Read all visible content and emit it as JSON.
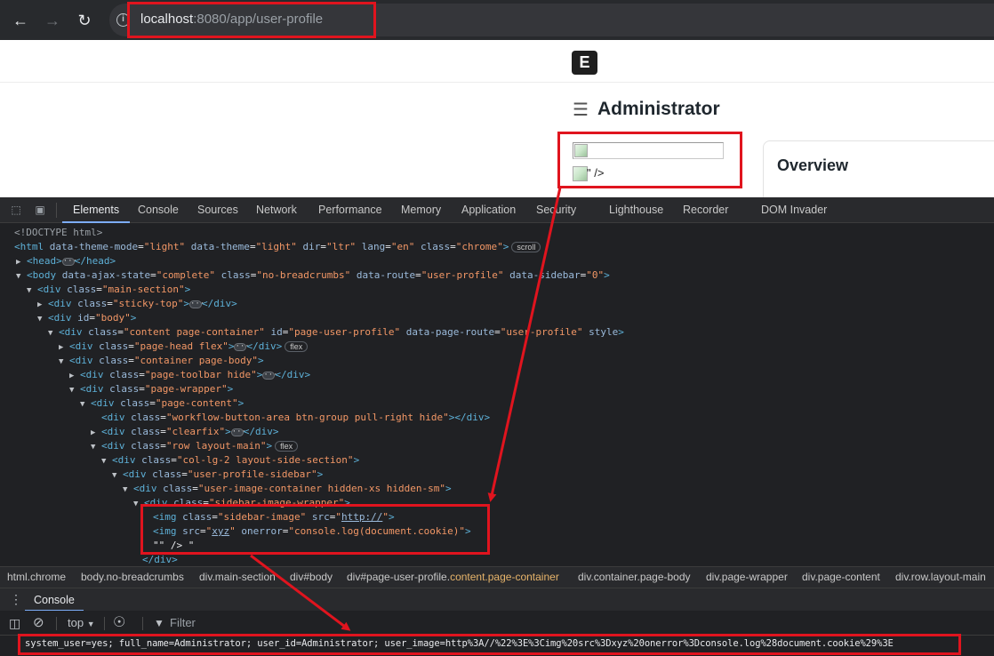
{
  "browser": {
    "url_host": "localhost",
    "url_path": ":8080/app/user-profile",
    "info_icon": "i"
  },
  "page": {
    "logo_letter": "E",
    "title": "Administrator",
    "broken_residue": "\" />",
    "overview_title": "Overview"
  },
  "devtools": {
    "tabs": [
      "Elements",
      "Console",
      "Sources",
      "Network",
      "Performance",
      "Memory",
      "Application",
      "Security",
      "Lighthouse",
      "Recorder",
      "DOM Invader"
    ],
    "tree": {
      "doctype": "<!DOCTYPE html>",
      "scroll_pill": "scroll",
      "flex_pill": "flex",
      "payload_text": "\"\" /> \""
    },
    "breadcrumbs": [
      "html.chrome",
      "body.no-breadcrumbs",
      "div.main-section",
      "div#body",
      "div#page-user-profile.",
      "content.page-container",
      "div.container.page-body",
      "div.page-wrapper",
      "div.page-content",
      "div.row.layout-main"
    ],
    "console_tab": "Console",
    "context": "top",
    "filter_placeholder": "Filter",
    "console_output": "system_user=yes; full_name=Administrator; user_id=Administrator; user_image=http%3A//%22%3E%3Cimg%20src%3Dxyz%20onerror%3Dconsole.log%28document.cookie%29%3E"
  },
  "colors": {
    "annotation_red": "#e0141e",
    "devtools_bg": "#202124",
    "tag_blue": "#5db0d7",
    "attr_value_orange": "#f29766"
  }
}
